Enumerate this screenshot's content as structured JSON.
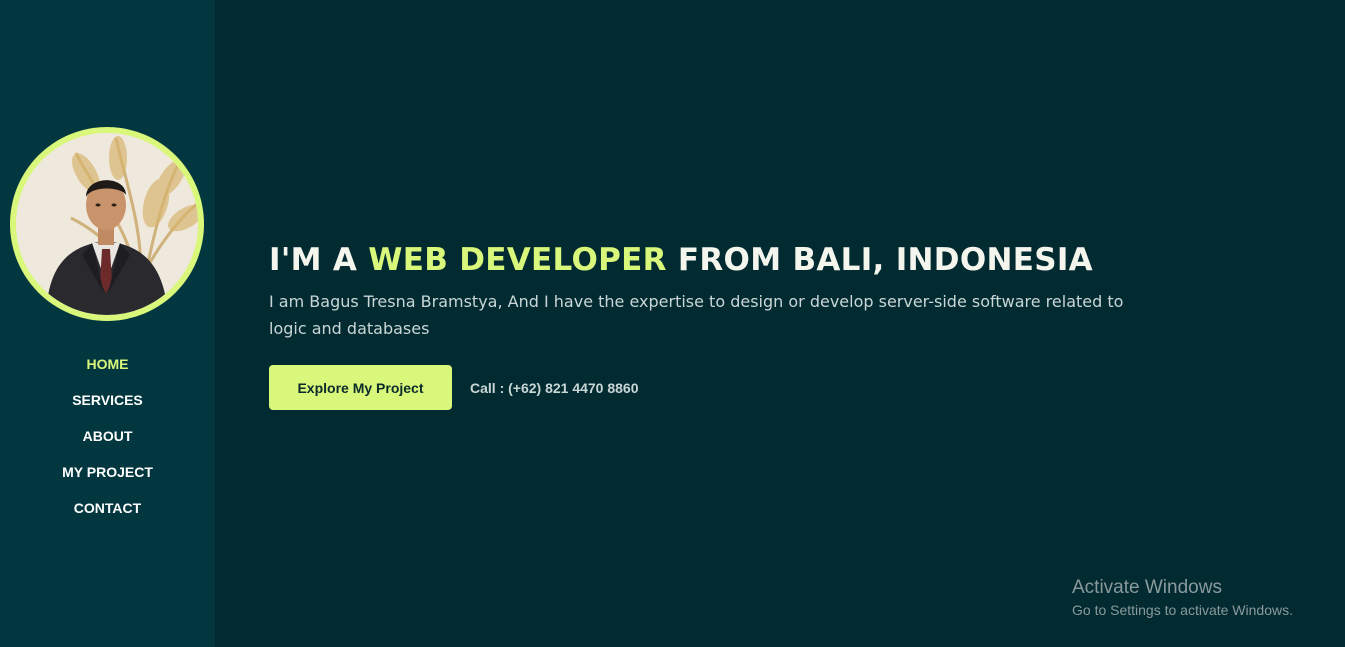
{
  "sidebar": {
    "avatar_alt": "profile photo",
    "accent_color": "#d9f77a",
    "nav": [
      {
        "label": "HOME",
        "active": true
      },
      {
        "label": "SERVICES",
        "active": false
      },
      {
        "label": "ABOUT",
        "active": false
      },
      {
        "label": "MY PROJECT",
        "active": false
      },
      {
        "label": "CONTACT",
        "active": false
      }
    ]
  },
  "hero": {
    "title_prefix": "I'M A ",
    "title_highlight": "WEB DEVELOPER",
    "title_suffix": " FROM BALI, INDONESIA",
    "description": "I am Bagus Tresna Bramstya, And I have the expertise to design or develop server-side software related to logic and databases",
    "cta_label": "Explore My Project",
    "call_text": "Call : (+62) 821 4470 8860"
  },
  "watermark": {
    "title": "Activate Windows",
    "subtitle": "Go to Settings to activate Windows."
  },
  "colors": {
    "background": "#022a31",
    "sidebar": "#033740",
    "accent": "#d9f77a",
    "heading": "#f4f6ee",
    "body_text": "#c9d6d6"
  }
}
